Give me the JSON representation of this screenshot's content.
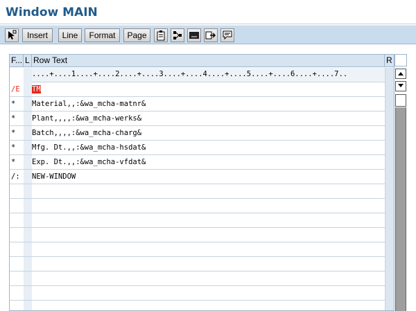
{
  "window": {
    "title": "Window MAIN"
  },
  "toolbar": {
    "buttons": [
      "Insert",
      "Line",
      "Format",
      "Page"
    ],
    "icons": [
      "select-mode-icon",
      "clipboard-icon",
      "structure-icon",
      "screen-icon",
      "export-icon",
      "comment-icon"
    ]
  },
  "grid": {
    "headers": {
      "format": "F...",
      "line": "L",
      "text": "Row Text",
      "right": "R"
    },
    "ruler": "....+....1....+....2....+....3....+....4....+....5....+....6....+....7..",
    "rows": [
      {
        "format": "/E",
        "text": "TM",
        "highlight": true
      },
      {
        "format": "*",
        "text": "Material,,:&wa_mcha-matnr&"
      },
      {
        "format": "*",
        "text": "Plant,,,,:&wa_mcha-werks&"
      },
      {
        "format": "*",
        "text": "Batch,,,,:&wa_mcha-charg&"
      },
      {
        "format": "*",
        "text": "Mfg. Dt.,,:&wa_mcha-hsdat&"
      },
      {
        "format": "*",
        "text": "Exp. Dt.,,:&wa_mcha-vfdat&"
      },
      {
        "format": "/:",
        "text": "NEW-WINDOW"
      },
      {
        "format": "",
        "text": ""
      },
      {
        "format": "",
        "text": ""
      },
      {
        "format": "",
        "text": ""
      },
      {
        "format": "",
        "text": ""
      },
      {
        "format": "",
        "text": ""
      },
      {
        "format": "",
        "text": ""
      },
      {
        "format": "",
        "text": ""
      },
      {
        "format": "",
        "text": ""
      }
    ]
  },
  "colors": {
    "title": "#1f5b8c",
    "toolbar": "#c9dcee",
    "highlight": "#e0281c"
  }
}
